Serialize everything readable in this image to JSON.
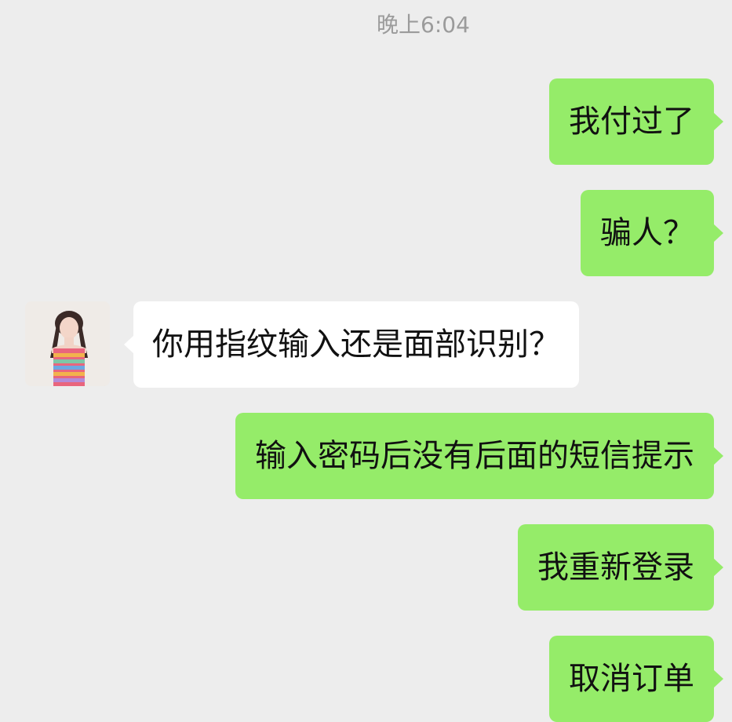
{
  "header": {
    "timestamp": "晚上6:04"
  },
  "messages": [
    {
      "side": "sent",
      "text": "我付过了"
    },
    {
      "side": "sent",
      "text": "骗人？"
    },
    {
      "side": "received",
      "text": "你用指纹输入还是面部识别？",
      "avatar_icon": "girl-avatar-icon"
    },
    {
      "side": "sent",
      "text": "输入密码后没有后面的短信提示"
    },
    {
      "side": "sent",
      "text": "我重新登录"
    },
    {
      "side": "sent",
      "text": "取消订单"
    }
  ],
  "colors": {
    "background": "#ededed",
    "sent_bubble": "#95ec69",
    "received_bubble": "#ffffff",
    "timestamp_text": "#9b9b9b"
  }
}
